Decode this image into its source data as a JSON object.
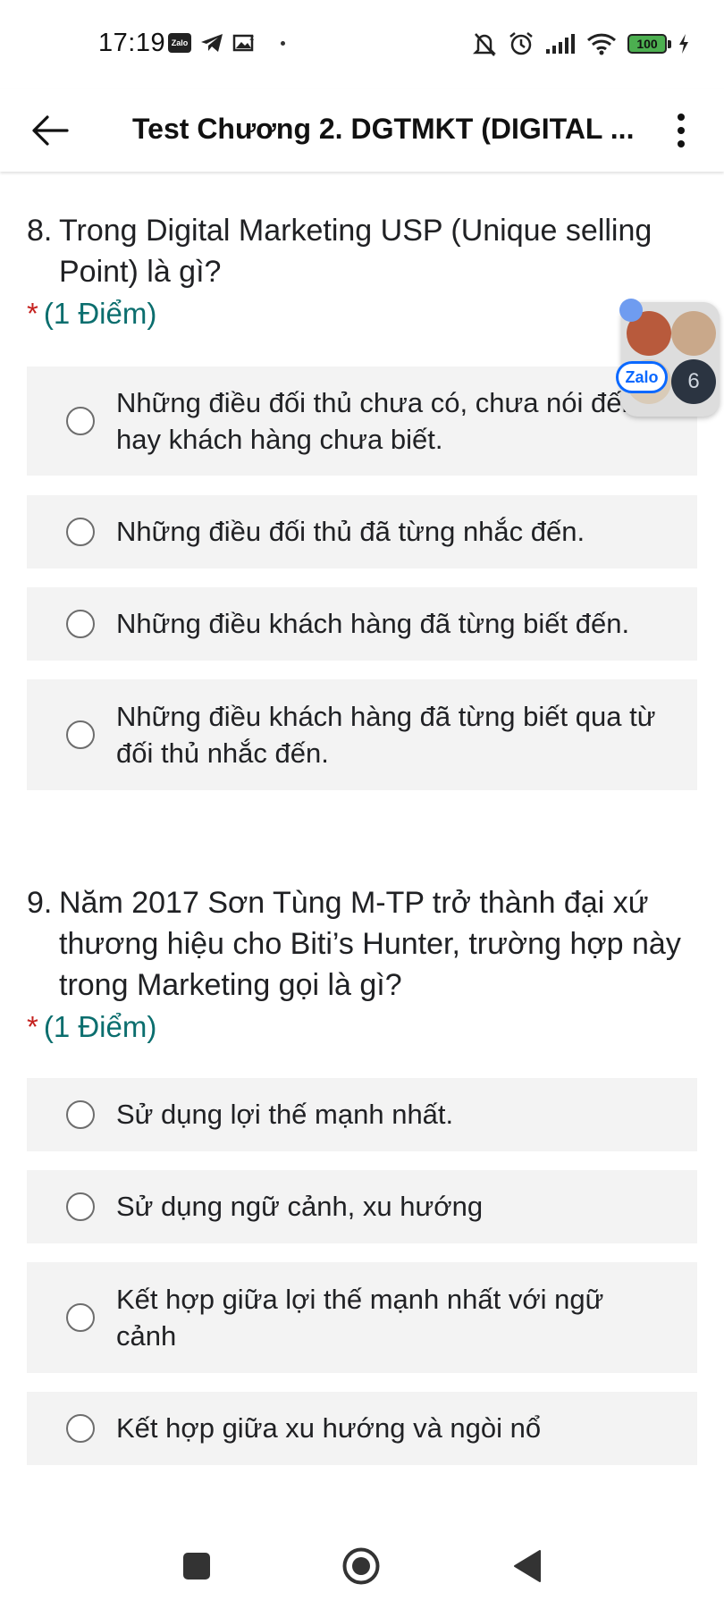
{
  "status_bar": {
    "time": "17:19",
    "zalo_label": "Zalo",
    "battery": "100"
  },
  "app_bar": {
    "title": "Test Chương 2. DGTMKT (DIGITAL ..."
  },
  "questions": [
    {
      "number": "8.",
      "text": "Trong Digital Marketing USP (Unique selling Point) là gì?",
      "required_mark": "*",
      "points": "(1 Điểm)",
      "options": [
        "Những điều đối thủ chưa có, chưa nói đến hay khách hàng chưa biết.",
        "Những điều đối thủ đã từng nhắc đến.",
        "Những điều khách hàng đã từng biết đến.",
        "Những điều khách hàng đã từng biết qua từ đối thủ nhắc đến."
      ]
    },
    {
      "number": "9.",
      "text": "Năm 2017 Sơn Tùng M-TP trở thành đại xứ thương hiệu cho Biti’s Hunter, trường hợp này trong Marketing gọi là gì?",
      "required_mark": "*",
      "points": "(1 Điểm)",
      "options": [
        "Sử dụng lợi thế mạnh nhất.",
        "Sử dụng ngữ cảnh, xu hướng",
        "Kết hợp giữa lợi thế mạnh nhất với ngữ cảnh",
        "Kết hợp giữa xu hướng và ngòi nổ"
      ]
    }
  ],
  "zalo_bubble": {
    "badge": "Zalo",
    "count": "6"
  },
  "colors": {
    "points": "#0b6e6e",
    "required": "#c5221f",
    "option_bg": "#f3f3f3",
    "zalo_blue": "#0a68ff"
  }
}
